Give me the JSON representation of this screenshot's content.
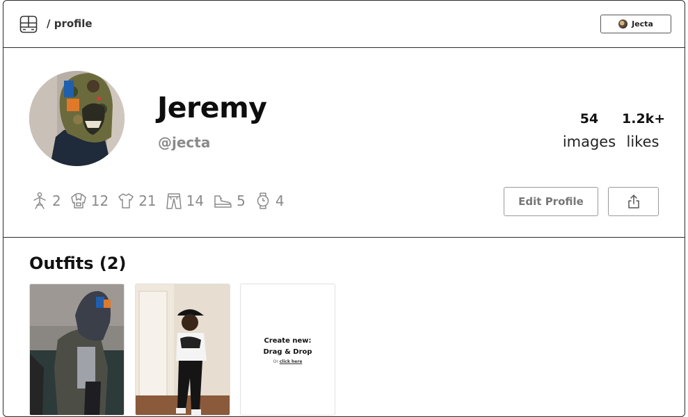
{
  "header": {
    "breadcrumb": "/ profile",
    "user_chip_label": "Jecta"
  },
  "profile": {
    "name": "Jeremy",
    "handle": "@jecta",
    "stats": [
      {
        "value": "54",
        "label": "images"
      },
      {
        "value": "1.2k+",
        "label": "likes"
      }
    ],
    "counts": [
      {
        "icon": "person-icon",
        "value": "2"
      },
      {
        "icon": "hoodie-icon",
        "value": "12"
      },
      {
        "icon": "tshirt-icon",
        "value": "21"
      },
      {
        "icon": "pants-icon",
        "value": "14"
      },
      {
        "icon": "shoe-icon",
        "value": "5"
      },
      {
        "icon": "watch-icon",
        "value": "4"
      }
    ],
    "edit_label": "Edit Profile"
  },
  "outfits": {
    "title": "Outfits (2)",
    "create": {
      "line1": "Create new:",
      "line2": "Drag & Drop",
      "or_text": "Or",
      "link_text": "click here"
    }
  },
  "colors": {
    "border": "#2a2a2a",
    "muted_text": "#8a8a8a",
    "button_border": "#999999"
  }
}
